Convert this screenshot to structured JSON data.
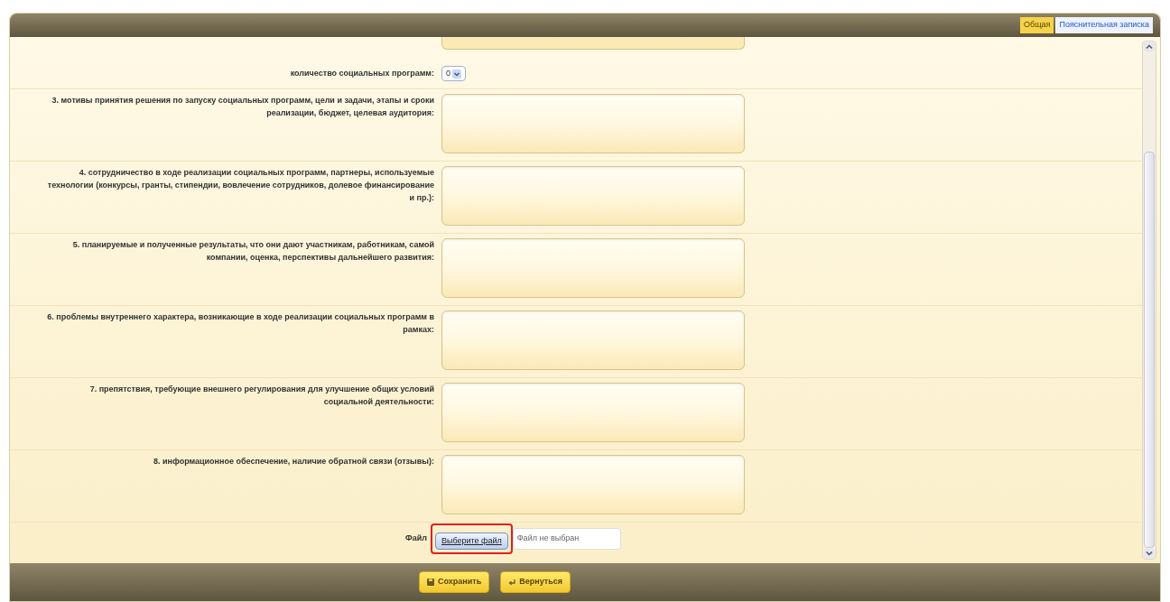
{
  "tabs": [
    {
      "label": "Общая",
      "selected": true
    },
    {
      "label": "Пояснительная записка",
      "selected": false
    }
  ],
  "count_field": {
    "label": "количество социальных программ:",
    "value": "0"
  },
  "questions": [
    {
      "label": "3. мотивы принятия решения по запуску социальных программ, цели и задачи, этапы и сроки реализации, бюджет, целевая аудитория:"
    },
    {
      "label": "4. сотрудничество в ходе реализации социальных программ, партнеры, используемые технологии (конкурсы, гранты, стипендии, вовлечение сотрудников, долевое финансирование и пр.):"
    },
    {
      "label": "5. планируемые и полученные результаты, что они дают участникам, работникам, самой компании, оценка, перспективы дальнейшего развития:"
    },
    {
      "label": "6. проблемы внутреннего характера, возникающие в ходе реализации социальных программ в рамках:"
    },
    {
      "label": "7. препятствия, требующие внешнего регулирования для улучшение общих условий социальной деятельности:"
    },
    {
      "label": "8. информационное обеспечение, наличие обратной связи (отзывы):"
    }
  ],
  "file_field": {
    "label": "Файл",
    "button": "Выберите файл",
    "status": "Файл не выбран",
    "highlighted": true
  },
  "buttons": [
    {
      "kind": "save",
      "label": "Сохранить"
    },
    {
      "kind": "back",
      "label": "Вернуться"
    }
  ]
}
